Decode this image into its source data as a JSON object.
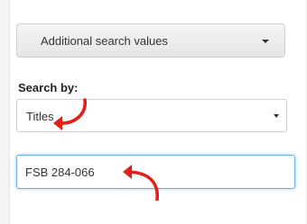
{
  "search_panel": {
    "additional_values_button": "Additional search values",
    "search_by_label": "Search by:",
    "search_by_selected": "Titles",
    "query_value": "FSB 284-066"
  },
  "annotation": {
    "arrow_color": "#e0201b"
  }
}
